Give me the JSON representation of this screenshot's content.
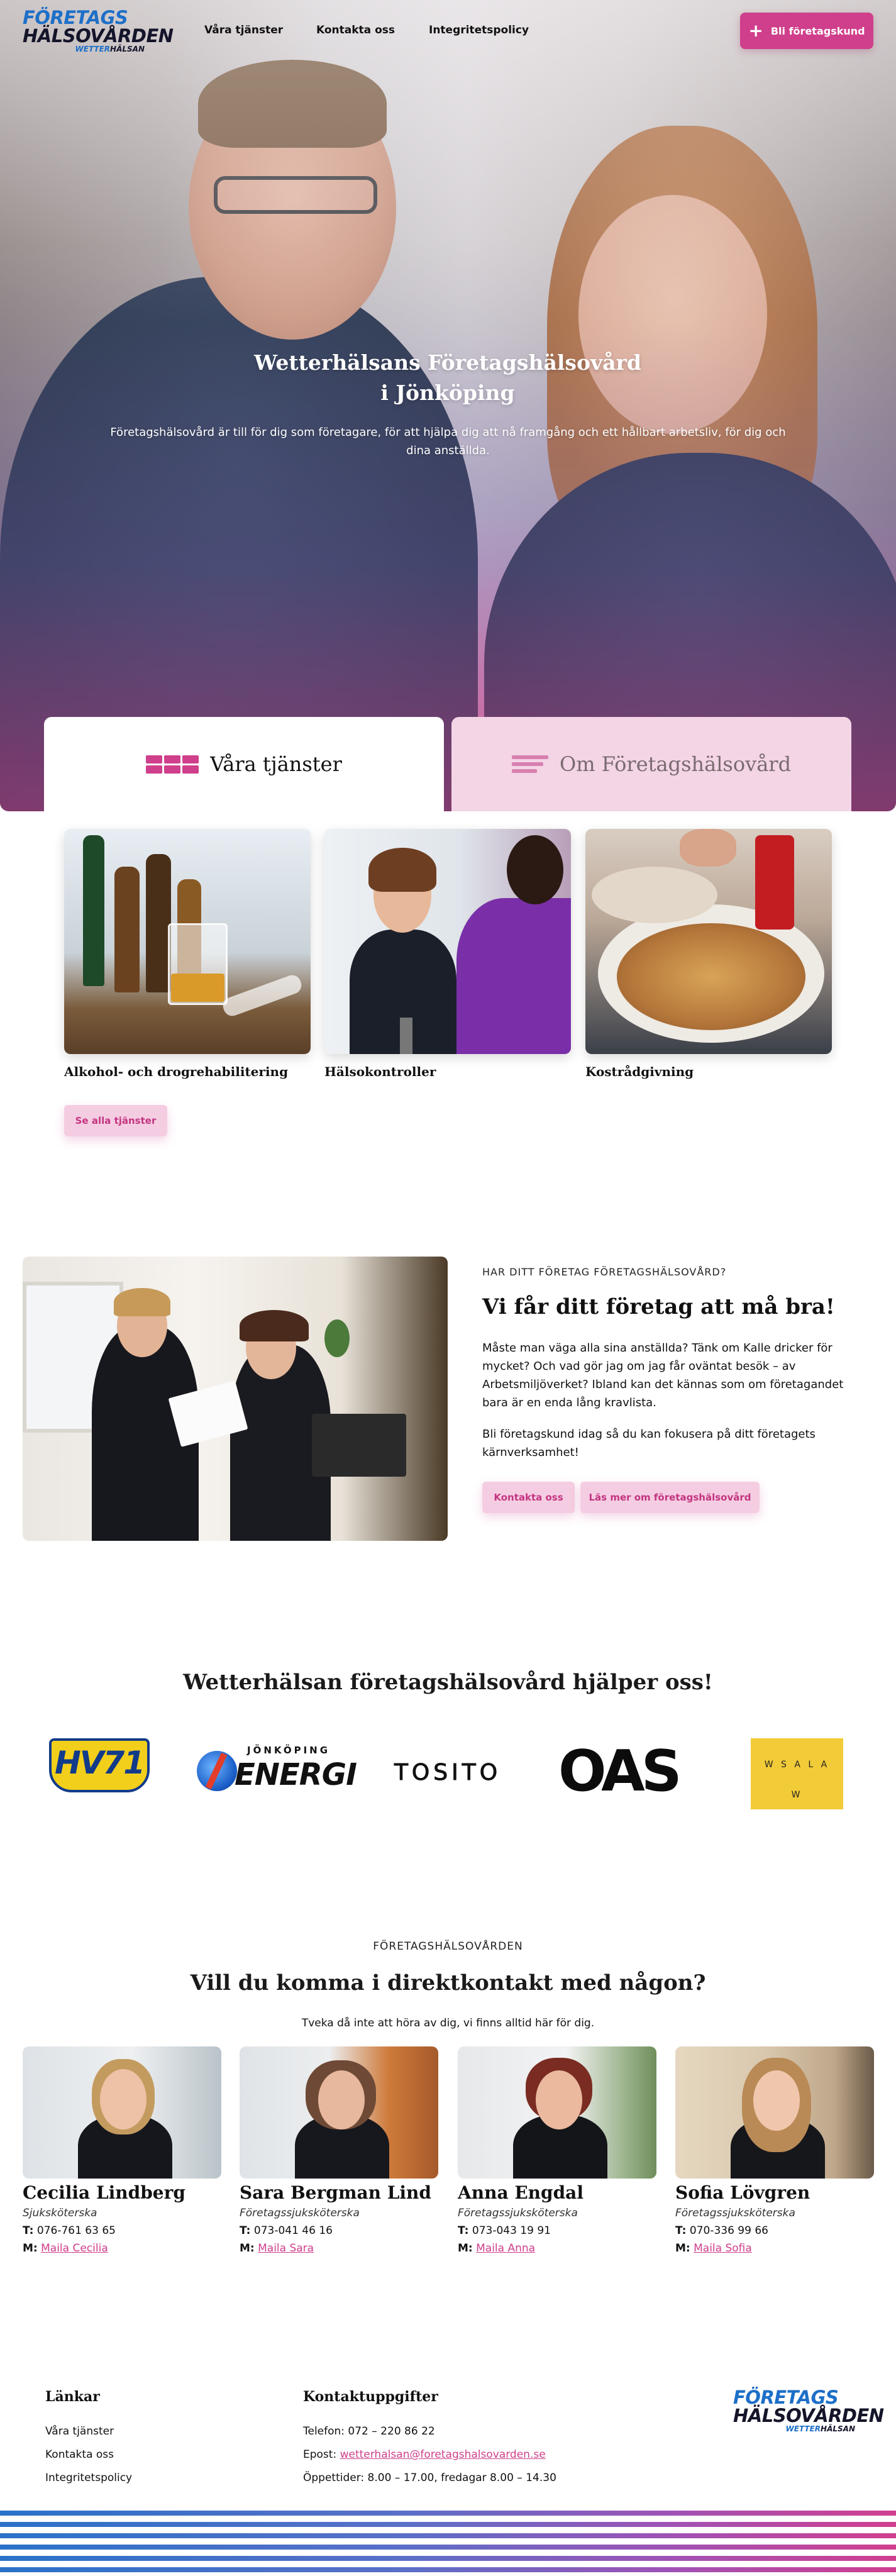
{
  "header": {
    "logo": {
      "line1": "FÖRETAGS",
      "line2": "HÄLSOVÅRDEN",
      "line3a": "WETTER",
      "line3b": "HÄLSAN"
    },
    "nav": [
      "Våra tjänster",
      "Kontakta oss",
      "Integritetspolicy"
    ],
    "cta_label": "Bli företagskund"
  },
  "hero": {
    "title_line1": "Wetterhälsans Företagshälsovård",
    "title_line2": "i Jönköping",
    "subtitle": "Företagshälsovård är till för dig som företagare, för att hjälpa dig att nå framgång och ett hållbart arbetsliv, för dig och dina anställda."
  },
  "tabs": [
    {
      "label": "Våra tjänster",
      "icon": "grid-icon"
    },
    {
      "label": "Om Företagshälsovård",
      "icon": "lines-icon"
    }
  ],
  "services": {
    "items": [
      {
        "label": "Alkohol- och drogrehabilitering"
      },
      {
        "label": "Hälsokontroller"
      },
      {
        "label": "Kostrådgivning"
      }
    ],
    "see_all": "Se alla tjänster"
  },
  "about": {
    "eyebrow": "HAR DITT FÖRETAG FÖRETAGSHÄLSOVÅRD?",
    "heading": "Vi får ditt företag att må bra!",
    "paragraph1": "Måste man väga alla sina anställda? Tänk om Kalle dricker för mycket? Och vad gör jag om jag får oväntat besök – av Arbetsmiljöverket? Ibland kan det kännas som om företagandet bara är en enda lång kravlista.",
    "paragraph2": "Bli företagskund idag så du kan fokusera på ditt företagets kärnverksamhet!",
    "btn_contact": "Kontakta oss",
    "btn_more": "Läs mer om företagshälsovård"
  },
  "partners": {
    "heading": "Wetterhälsan företagshälsovård hjälper oss!",
    "logos": [
      {
        "name": "hv71-logo",
        "text": "HV71"
      },
      {
        "name": "jonkoping-energi-logo",
        "text_top": "JÖNKÖPING",
        "text_main": "ENERGI"
      },
      {
        "name": "tosito-logo",
        "text": "TOSITO"
      },
      {
        "name": "oas-logo",
        "text": "OAS"
      },
      {
        "name": "wsa-law-logo",
        "text": "W S A L A W"
      }
    ]
  },
  "staff_section": {
    "eyebrow": "FÖRETAGSHÄLSOVÅRDEN",
    "heading": "Vill du komma i direktkontakt med någon?",
    "subtitle": "Tveka då inte att höra av dig, vi finns alltid här för dig.",
    "phone_prefix": "T:",
    "mail_prefix": "M:",
    "people": [
      {
        "name": "Cecilia Lindberg",
        "role": "Sjuksköterska",
        "phone": "076-761 63 65",
        "mail": "Maila Cecilia"
      },
      {
        "name": "Sara Bergman Lind",
        "role": "Företagssjuksköterska",
        "phone": "073-041 46 16",
        "mail": "Maila Sara"
      },
      {
        "name": "Anna Engdal",
        "role": "Företagssjuksköterska",
        "phone": "073-043 19 91",
        "mail": "Maila Anna"
      },
      {
        "name": "Sofia Lövgren",
        "role": "Företagssjuksköterska",
        "phone": "070-336 99 66",
        "mail": "Maila Sofia"
      }
    ]
  },
  "footer": {
    "links_heading": "Länkar",
    "links": [
      "Våra tjänster",
      "Kontakta oss",
      "Integritetspolicy"
    ],
    "contact_heading": "Kontaktuppgifter",
    "phone": "Telefon: 072 – 220 86 22",
    "email_prefix": "Epost: ",
    "email": "wetterhalsan@foretagshalsovarden.se",
    "hours": "Öppettider: 8.00 – 17.00, fredagar 8.00 – 14.30"
  },
  "colors": {
    "brand_pink": "#cf3f8b",
    "light_pink": "#f5cde2",
    "brand_blue": "#1d6fc8"
  }
}
